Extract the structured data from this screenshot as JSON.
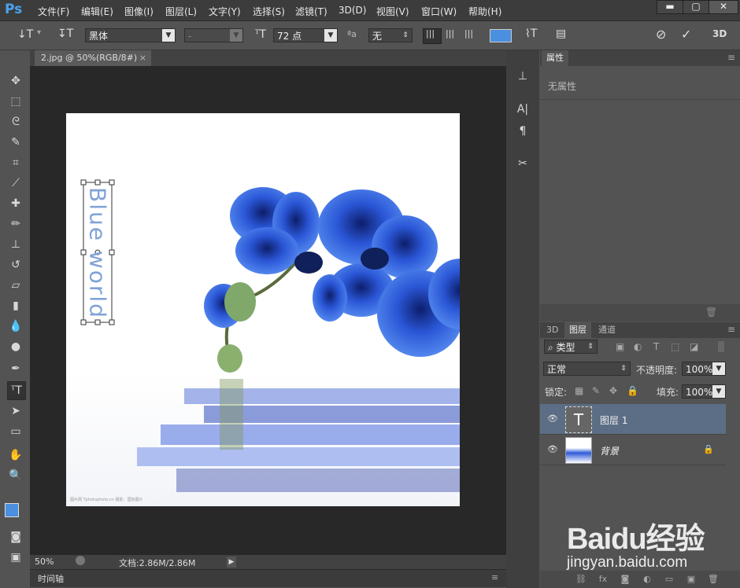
{
  "app": {
    "logo": "Ps"
  },
  "menu": [
    "文件(F)",
    "编辑(E)",
    "图像(I)",
    "图层(L)",
    "文字(Y)",
    "选择(S)",
    "滤镜(T)",
    "3D(D)",
    "视图(V)",
    "窗口(W)",
    "帮助(H)"
  ],
  "window_controls": {
    "minimize": "▬",
    "maximize": "▢",
    "close": "✕"
  },
  "options": {
    "font_family": "黑体",
    "font_style": "-",
    "font_size": "72 点",
    "antialias_label": "ªa",
    "antialias": "无",
    "three_d": "3D"
  },
  "document": {
    "tab_title": "2.jpg @ 50%(RGB/8#)"
  },
  "canvas": {
    "text_layer": "Blue world",
    "watermark_text": "图片网 Tphotophoto.cn 摄影：国际图片"
  },
  "status": {
    "zoom": "50%",
    "doc_size": "文档:2.86M/2.86M"
  },
  "timeline": {
    "label": "时间轴"
  },
  "properties": {
    "tab": "属性",
    "empty_text": "无属性"
  },
  "layers_panel": {
    "tabs": [
      "3D",
      "图层",
      "通道"
    ],
    "filter_kind": "类型",
    "blend_mode": "正常",
    "opacity_label": "不透明度:",
    "opacity_value": "100%",
    "lock_label": "锁定:",
    "fill_label": "填充:",
    "fill_value": "100%",
    "layers": [
      {
        "name": "图层 1",
        "type": "text",
        "selected": true
      },
      {
        "name": "背景",
        "type": "image",
        "locked": true
      }
    ]
  },
  "brand_watermark": {
    "logo": "Baidu经验",
    "url": "jingyan.baidu.com"
  },
  "colors": {
    "accent_blue": "#4a8fe0",
    "selected_layer": "#5c6e85",
    "text_on_canvas": "#7fa2d6"
  }
}
